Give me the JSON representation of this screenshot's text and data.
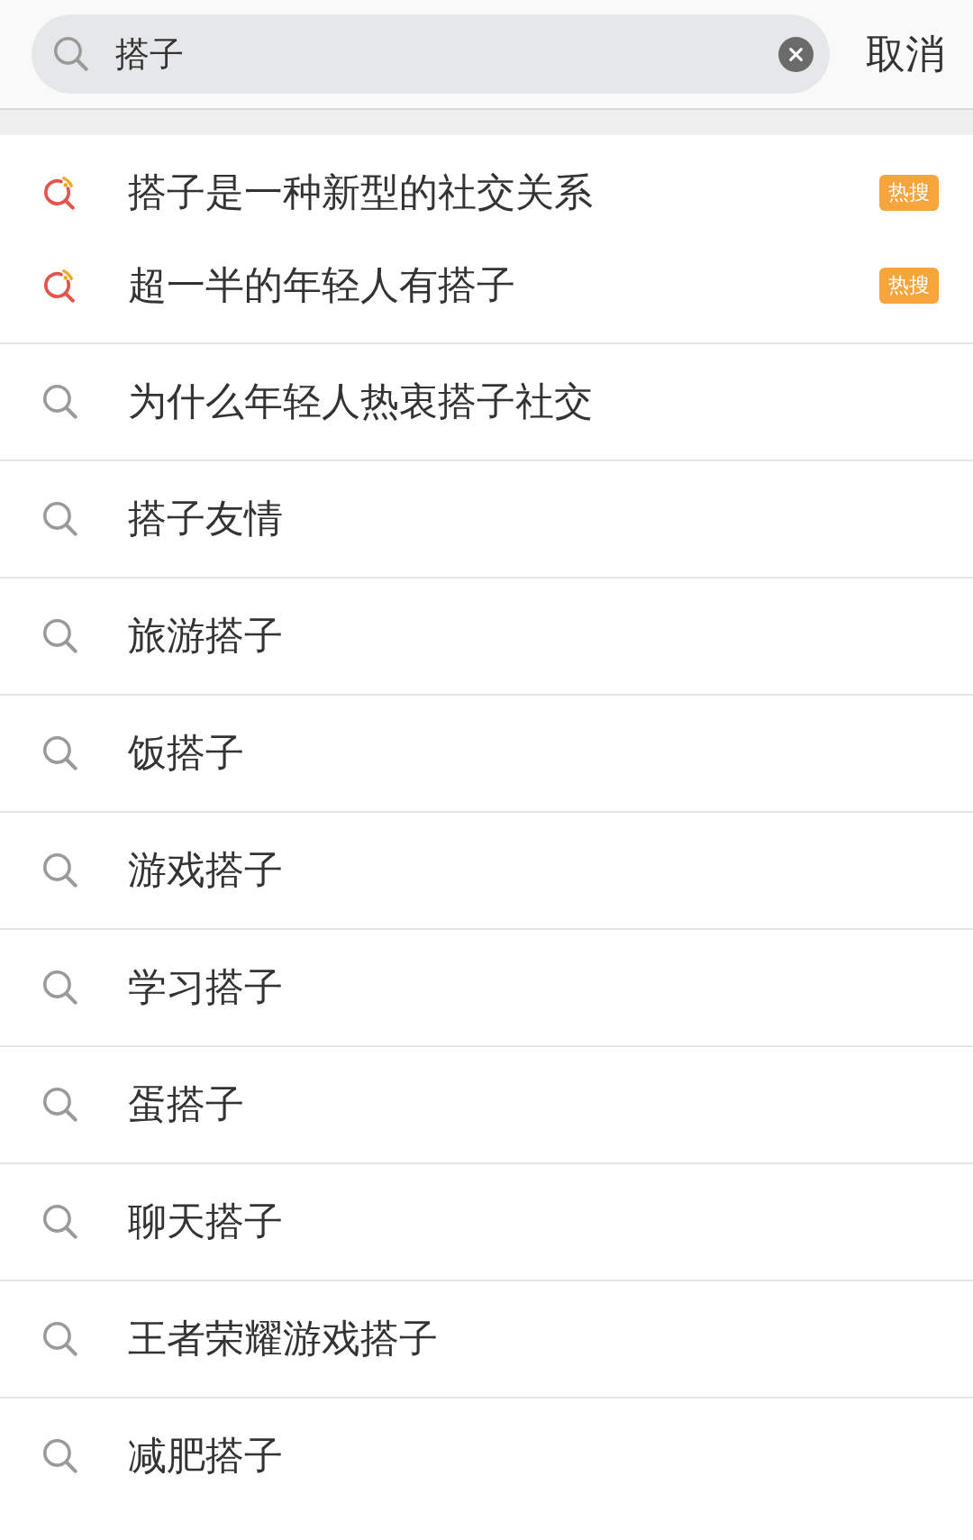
{
  "search": {
    "value": "搭子",
    "cancel": "取消"
  },
  "suggestions": [
    {
      "kind": "hot",
      "text": "搭子是一种新型的社交关系",
      "badge": "热搜"
    },
    {
      "kind": "hot",
      "text": "超一半的年轻人有搭子",
      "badge": "热搜"
    },
    {
      "kind": "plain",
      "text": "为什么年轻人热衷搭子社交"
    },
    {
      "kind": "plain",
      "text": "搭子友情"
    },
    {
      "kind": "plain",
      "text": "旅游搭子"
    },
    {
      "kind": "plain",
      "text": "饭搭子"
    },
    {
      "kind": "plain",
      "text": "游戏搭子"
    },
    {
      "kind": "plain",
      "text": "学习搭子"
    },
    {
      "kind": "plain",
      "text": "蛋搭子"
    },
    {
      "kind": "plain",
      "text": "聊天搭子"
    },
    {
      "kind": "plain",
      "text": "王者荣耀游戏搭子"
    },
    {
      "kind": "plain",
      "text": "减肥搭子"
    }
  ]
}
